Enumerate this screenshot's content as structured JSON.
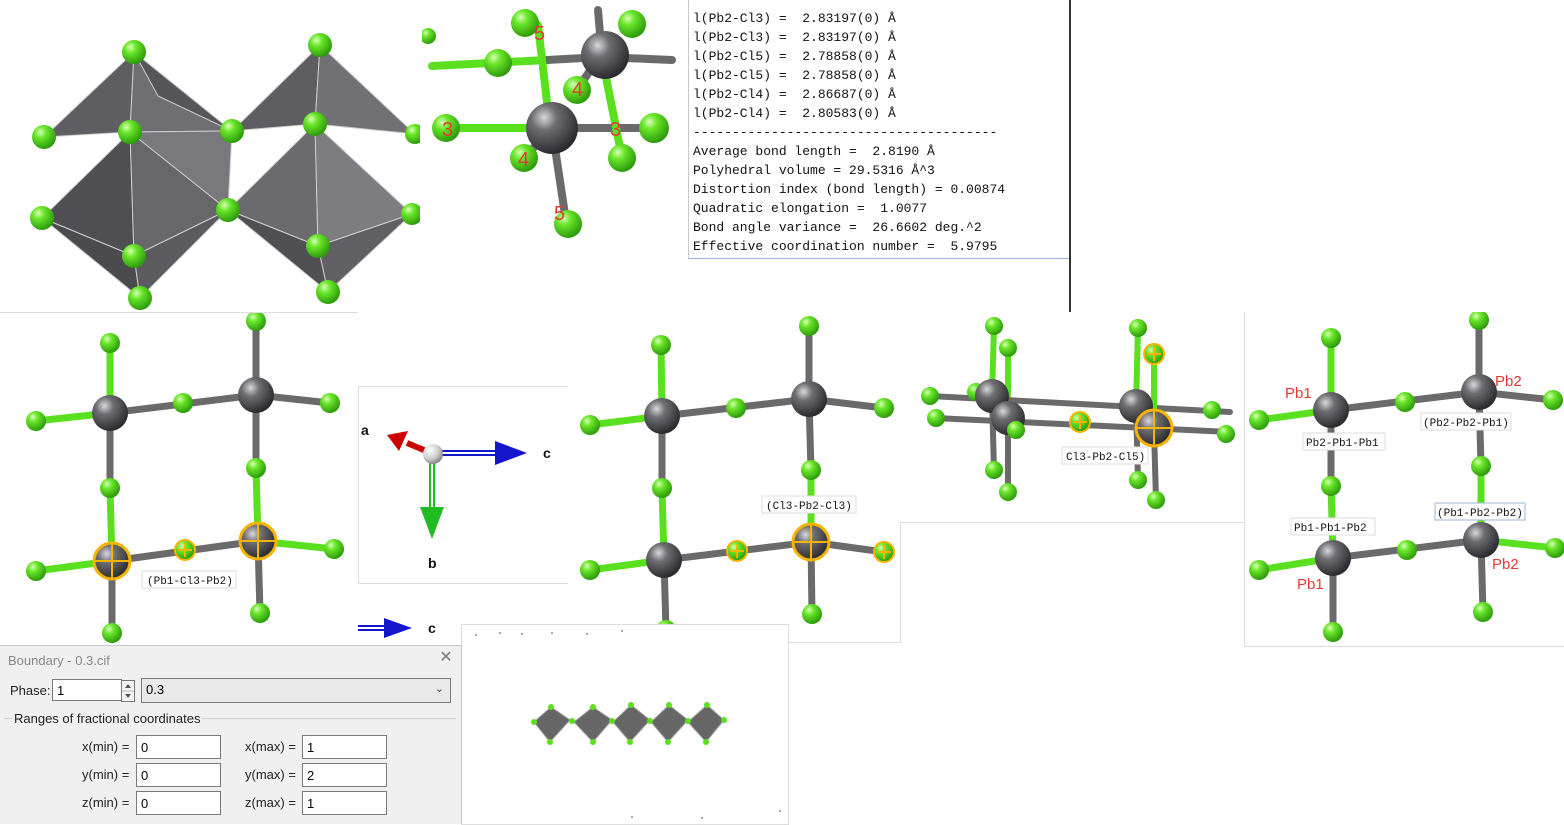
{
  "text_output": {
    "lines": [
      "l(Pb2-Cl3) =  2.83197(0) Å",
      "l(Pb2-Cl3) =  2.83197(0) Å",
      "l(Pb2-Cl5) =  2.78858(0) Å",
      "l(Pb2-Cl5) =  2.78858(0) Å",
      "l(Pb2-Cl4) =  2.86687(0) Å",
      "l(Pb2-Cl4) =  2.80583(0) Å",
      "---------------------------------------",
      "Average bond length =  2.8190 Å",
      "Polyhedral volume = 29.5316 Å^3",
      "Distortion index (bond length) = 0.00874",
      "Quadratic elongation =  1.0077",
      "Bond angle variance =  26.6602 deg.^2",
      "Effective coordination number =  5.9795"
    ]
  },
  "top_closeup": {
    "numbers": [
      "5",
      "4",
      "3",
      "3",
      "4",
      "5"
    ]
  },
  "axes_panel": {
    "a": "a",
    "b": "b",
    "c": "c"
  },
  "small_axis": {
    "c": "c"
  },
  "panel_left": {
    "angle_tag": "(Pb1-Cl3-Pb2)"
  },
  "panel_mid": {
    "angle_tag": "(Cl3-Pb2-Cl3)"
  },
  "panel_top_right": {
    "angle_tag": "Cl3-Pb2-Cl5)"
  },
  "panel_right": {
    "atom_labels": [
      "Pb1",
      "Pb2",
      "Pb1",
      "Pb2"
    ],
    "angle_tags": [
      "Pb2-Pb1-Pb1",
      "(Pb2-Pb2-Pb1)",
      "Pb1-Pb1-Pb2",
      "(Pb1-Pb2-Pb2)"
    ]
  },
  "colors": {
    "chlorine": "#5be01f",
    "lead": "#5a5a5e",
    "bond": "#6a6a6a",
    "axis_a": "#cc0000",
    "axis_b": "#22bb22",
    "axis_c": "#1515cc",
    "label_red": "#e53935"
  },
  "dialog": {
    "title": "Boundary - 0.3.cif",
    "close_label": "✕",
    "phase_label": "Phase:",
    "phase_value": "1",
    "phase_select": "0.3",
    "ranges_title": "Ranges of fractional coordinates",
    "xmin_label": "x(min) =",
    "xmin_value": "0",
    "xmax_label": "x(max) =",
    "xmax_value": "1",
    "ymin_label": "y(min) =",
    "ymin_value": "0",
    "ymax_label": "y(max) =",
    "ymax_value": "2",
    "zmin_label": "z(min) =",
    "zmin_value": "0",
    "zmax_label": "z(max) =",
    "zmax_value": "1"
  }
}
